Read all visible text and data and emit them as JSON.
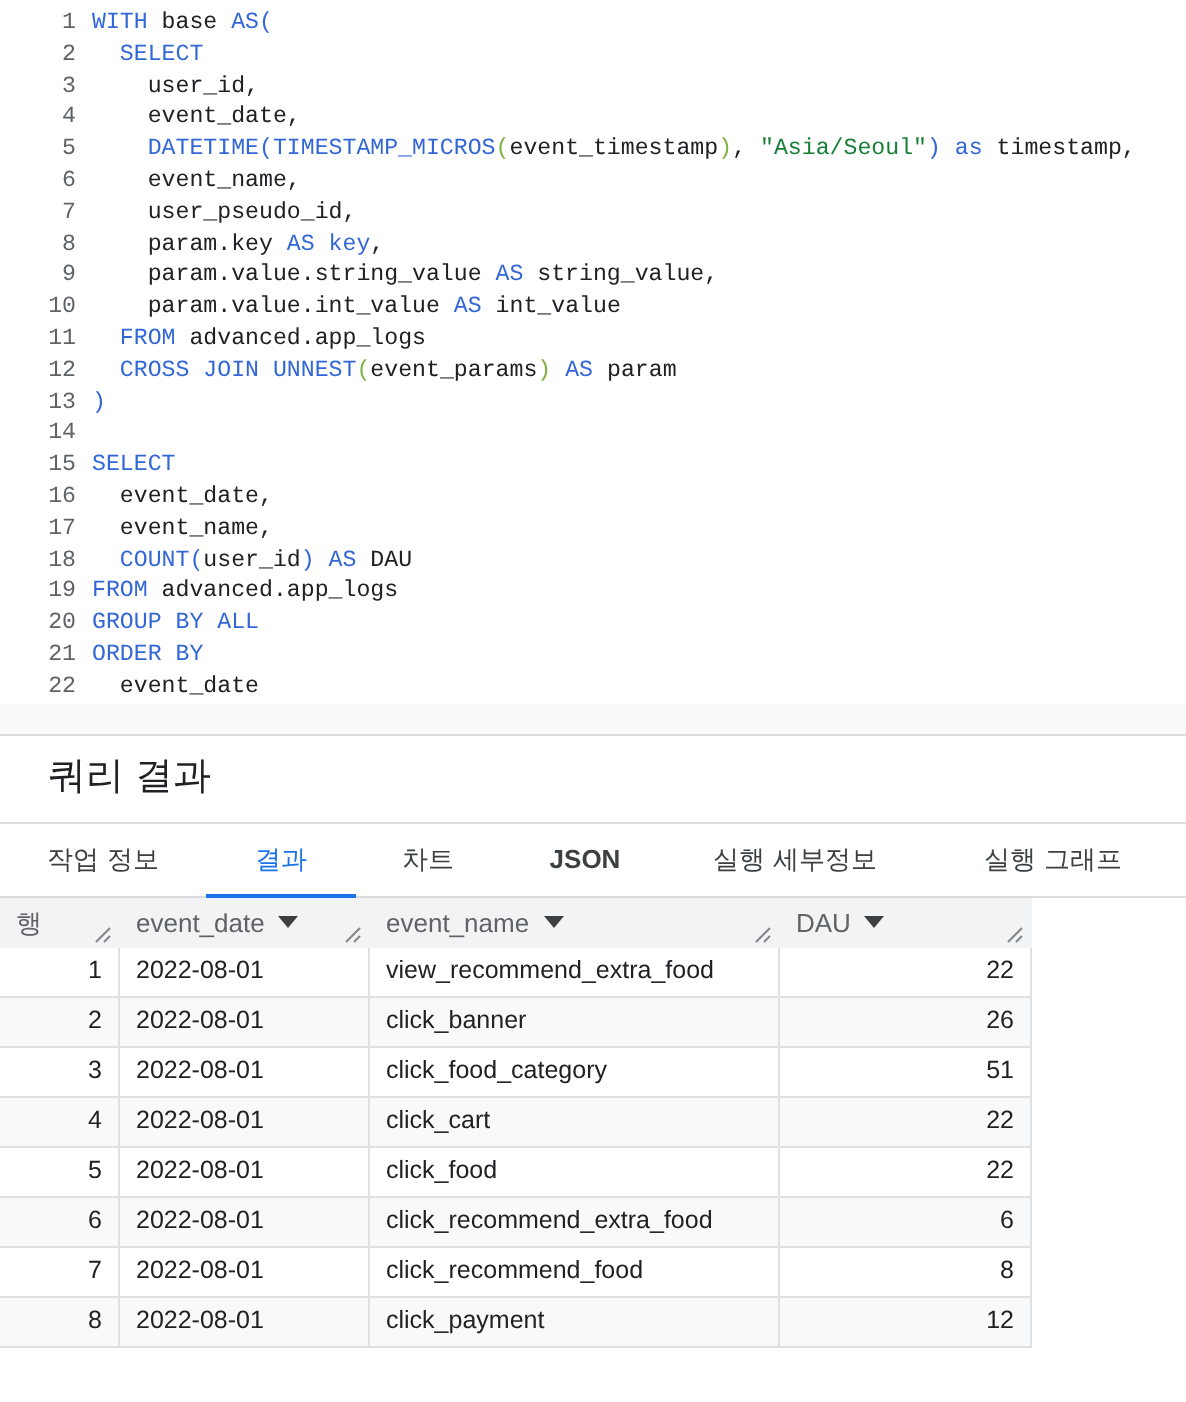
{
  "editor": {
    "lines": [
      {
        "number": "1",
        "tokens": [
          {
            "kind": "kw",
            "text": "WITH "
          },
          {
            "kind": "plain",
            "text": "base "
          },
          {
            "kind": "kw",
            "text": "AS("
          }
        ]
      },
      {
        "number": "2",
        "tokens": [
          {
            "kind": "kw",
            "text": "  SELECT"
          }
        ]
      },
      {
        "number": "3",
        "tokens": [
          {
            "kind": "plain",
            "text": "    user_id,"
          }
        ]
      },
      {
        "number": "4",
        "tokens": [
          {
            "kind": "plain",
            "text": "    event_date,"
          }
        ]
      },
      {
        "number": "5",
        "tokens": [
          {
            "kind": "kw",
            "text": "    DATETIME(TIMESTAMP_MICROS"
          },
          {
            "kind": "bracket",
            "text": "("
          },
          {
            "kind": "plain",
            "text": "event_timestamp"
          },
          {
            "kind": "bracket",
            "text": ")"
          },
          {
            "kind": "plain",
            "text": ", "
          },
          {
            "kind": "str",
            "text": "\"Asia/Seoul\""
          },
          {
            "kind": "kw",
            "text": ") as "
          },
          {
            "kind": "plain",
            "text": "timestamp,"
          }
        ]
      },
      {
        "number": "6",
        "tokens": [
          {
            "kind": "plain",
            "text": "    event_name,"
          }
        ]
      },
      {
        "number": "7",
        "tokens": [
          {
            "kind": "plain",
            "text": "    user_pseudo_id,"
          }
        ]
      },
      {
        "number": "8",
        "tokens": [
          {
            "kind": "plain",
            "text": "    param.key "
          },
          {
            "kind": "kw",
            "text": "AS key"
          },
          {
            "kind": "plain",
            "text": ","
          }
        ]
      },
      {
        "number": "9",
        "tokens": [
          {
            "kind": "plain",
            "text": "    param.value.string_value "
          },
          {
            "kind": "kw",
            "text": "AS "
          },
          {
            "kind": "plain",
            "text": "string_value,"
          }
        ]
      },
      {
        "number": "10",
        "tokens": [
          {
            "kind": "plain",
            "text": "    param.value.int_value "
          },
          {
            "kind": "kw",
            "text": "AS "
          },
          {
            "kind": "plain",
            "text": "int_value"
          }
        ]
      },
      {
        "number": "11",
        "tokens": [
          {
            "kind": "kw",
            "text": "  FROM "
          },
          {
            "kind": "plain",
            "text": "advanced.app_logs"
          }
        ]
      },
      {
        "number": "12",
        "tokens": [
          {
            "kind": "kw",
            "text": "  CROSS JOIN UNNEST"
          },
          {
            "kind": "bracket",
            "text": "("
          },
          {
            "kind": "plain",
            "text": "event_params"
          },
          {
            "kind": "bracket",
            "text": ")"
          },
          {
            "kind": "kw",
            "text": " AS "
          },
          {
            "kind": "plain",
            "text": "param"
          }
        ]
      },
      {
        "number": "13",
        "tokens": [
          {
            "kind": "kw",
            "text": ")"
          }
        ]
      },
      {
        "number": "14"
      },
      {
        "number": "15",
        "tokens": [
          {
            "kind": "kw",
            "text": "SELECT"
          }
        ]
      },
      {
        "number": "16",
        "tokens": [
          {
            "kind": "plain",
            "text": "  event_date,"
          }
        ]
      },
      {
        "number": "17",
        "tokens": [
          {
            "kind": "plain",
            "text": "  event_name,"
          }
        ]
      },
      {
        "number": "18",
        "tokens": [
          {
            "kind": "kw",
            "text": "  COUNT("
          },
          {
            "kind": "plain",
            "text": "user_id"
          },
          {
            "kind": "kw",
            "text": ") AS "
          },
          {
            "kind": "plain",
            "text": "DAU"
          }
        ]
      },
      {
        "number": "19",
        "tokens": [
          {
            "kind": "kw",
            "text": "FROM "
          },
          {
            "kind": "plain",
            "text": "advanced.app_logs"
          }
        ]
      },
      {
        "number": "20",
        "tokens": [
          {
            "kind": "kw",
            "text": "GROUP BY ALL"
          }
        ]
      },
      {
        "number": "21",
        "tokens": [
          {
            "kind": "kw",
            "text": "ORDER BY"
          }
        ]
      },
      {
        "number": "22",
        "tokens": [
          {
            "kind": "plain",
            "text": "  event_date"
          }
        ]
      }
    ]
  },
  "results": {
    "title": "쿼리 결과",
    "tabs": [
      {
        "label": "작업 정보",
        "selected": false
      },
      {
        "label": "결과",
        "selected": true
      },
      {
        "label": "차트",
        "selected": false
      },
      {
        "label": "JSON",
        "selected": false
      },
      {
        "label": "실행 세부정보",
        "selected": false
      },
      {
        "label": "실행 그래프",
        "selected": false
      }
    ],
    "table": {
      "columns": [
        {
          "label": "행",
          "sortable": false
        },
        {
          "label": "event_date",
          "sortable": true
        },
        {
          "label": "event_name",
          "sortable": true
        },
        {
          "label": "DAU",
          "sortable": true
        }
      ],
      "rows": [
        [
          "1",
          "2022-08-01",
          "view_recommend_extra_food",
          "22"
        ],
        [
          "2",
          "2022-08-01",
          "click_banner",
          "26"
        ],
        [
          "3",
          "2022-08-01",
          "click_food_category",
          "51"
        ],
        [
          "4",
          "2022-08-01",
          "click_cart",
          "22"
        ],
        [
          "5",
          "2022-08-01",
          "click_food",
          "22"
        ],
        [
          "6",
          "2022-08-01",
          "click_recommend_extra_food",
          "6"
        ],
        [
          "7",
          "2022-08-01",
          "click_recommend_food",
          "8"
        ],
        [
          "8",
          "2022-08-01",
          "click_payment",
          "12"
        ]
      ]
    }
  }
}
